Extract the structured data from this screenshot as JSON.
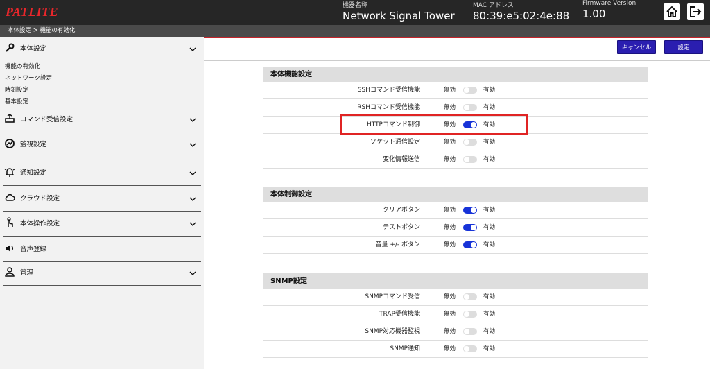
{
  "header": {
    "logo": "PATLITE",
    "model_label": "機器名称",
    "model_value": "Network Signal Tower",
    "mac_label": "MAC アドレス",
    "mac_value": "80:39:e5:02:4e:88",
    "fw_label": "Firmware Version",
    "fw_value": "1.00",
    "home_icon": "home-icon",
    "logout_icon": "logout-icon"
  },
  "breadcrumb": "本体設定 > 機能の有効化",
  "sidebar": {
    "items": [
      {
        "label": "本体設定",
        "icon": "wrench-icon"
      },
      {
        "label": "コマンド受信設定",
        "icon": "command-icon"
      },
      {
        "label": "監視設定",
        "icon": "gauge-icon"
      },
      {
        "label": "通知設定",
        "icon": "bell-icon"
      },
      {
        "label": "クラウド設定",
        "icon": "cloud-icon"
      },
      {
        "label": "本体操作設定",
        "icon": "hand-icon"
      },
      {
        "label": "音声登録",
        "icon": "speaker-icon"
      },
      {
        "label": "管理",
        "icon": "user-icon"
      }
    ],
    "subitems": [
      "機能の有効化",
      "ネットワーク設定",
      "時刻設定",
      "基本設定"
    ]
  },
  "toolbar": {
    "cancel_label": "キャンセル",
    "save_label": "設定"
  },
  "toggle_text": {
    "off": "無効",
    "on": "有効"
  },
  "sections": [
    {
      "title": "本体機能設定",
      "rows": [
        {
          "label": "SSHコマンド受信機能",
          "enabled": false
        },
        {
          "label": "RSHコマンド受信機能",
          "enabled": false
        },
        {
          "label": "HTTPコマンド制御",
          "enabled": true
        },
        {
          "label": "ソケット通信設定",
          "enabled": false
        },
        {
          "label": "変化情報送信",
          "enabled": false
        }
      ]
    },
    {
      "title": "本体制御設定",
      "rows": [
        {
          "label": "クリアボタン",
          "enabled": true
        },
        {
          "label": "テストボタン",
          "enabled": true
        },
        {
          "label": "音量 +/- ボタン",
          "enabled": true
        }
      ]
    },
    {
      "title": "SNMP設定",
      "rows": [
        {
          "label": "SNMPコマンド受信",
          "enabled": false
        },
        {
          "label": "TRAP受信機能",
          "enabled": false
        },
        {
          "label": "SNMP対応機器監視",
          "enabled": false
        },
        {
          "label": "SNMP通知",
          "enabled": false
        }
      ]
    }
  ],
  "colors": {
    "accent": "#2a1eb0",
    "toggle_on": "#1733d8",
    "highlight": "#e02424",
    "brand": "#e8262b"
  }
}
